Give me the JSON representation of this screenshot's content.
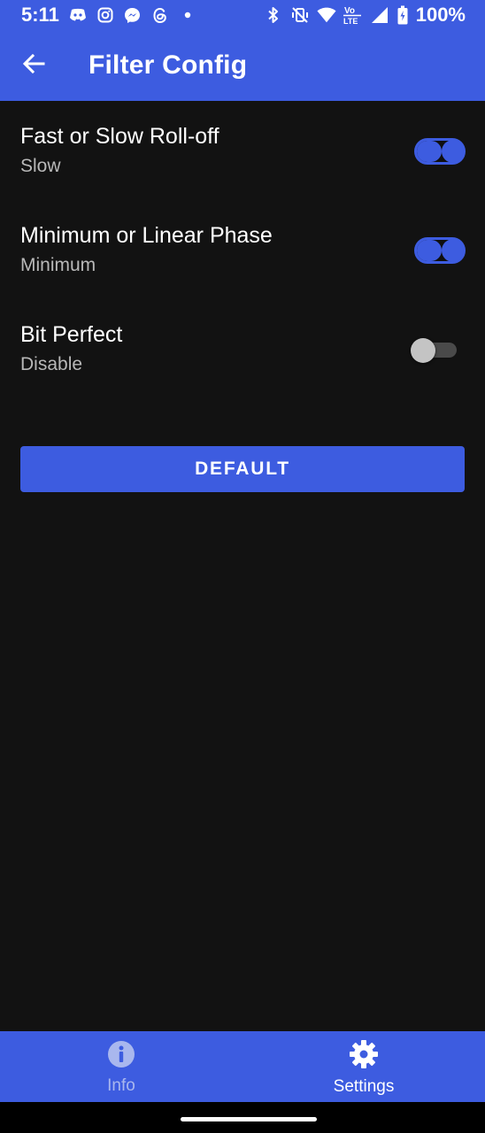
{
  "status_bar": {
    "time": "5:11",
    "battery": "100%",
    "left_icons": [
      "discord-icon",
      "instagram-icon",
      "messenger-icon",
      "threads-icon",
      "dot-icon"
    ],
    "right_icons": [
      "bluetooth-icon",
      "vibrate-off-icon",
      "wifi-icon",
      "volte-icon",
      "signal-icon",
      "battery-icon"
    ]
  },
  "app_bar": {
    "title": "Filter Config",
    "back_icon": "arrow-left-icon"
  },
  "settings": [
    {
      "title": "Fast or Slow Roll-off",
      "value": "Slow",
      "enabled": true
    },
    {
      "title": "Minimum or Linear Phase",
      "value": "Minimum",
      "enabled": true
    },
    {
      "title": "Bit Perfect",
      "value": "Disable",
      "enabled": false
    }
  ],
  "default_button": {
    "label": "DEFAULT"
  },
  "bottom_nav": {
    "items": [
      {
        "label": "Info",
        "icon": "info-icon",
        "active": false
      },
      {
        "label": "Settings",
        "icon": "gear-icon",
        "active": true
      }
    ]
  },
  "colors": {
    "accent": "#3d5ce0",
    "background": "#121212",
    "secondary_text": "#b8b8b8",
    "inactive_nav": "#a9b7ee"
  }
}
